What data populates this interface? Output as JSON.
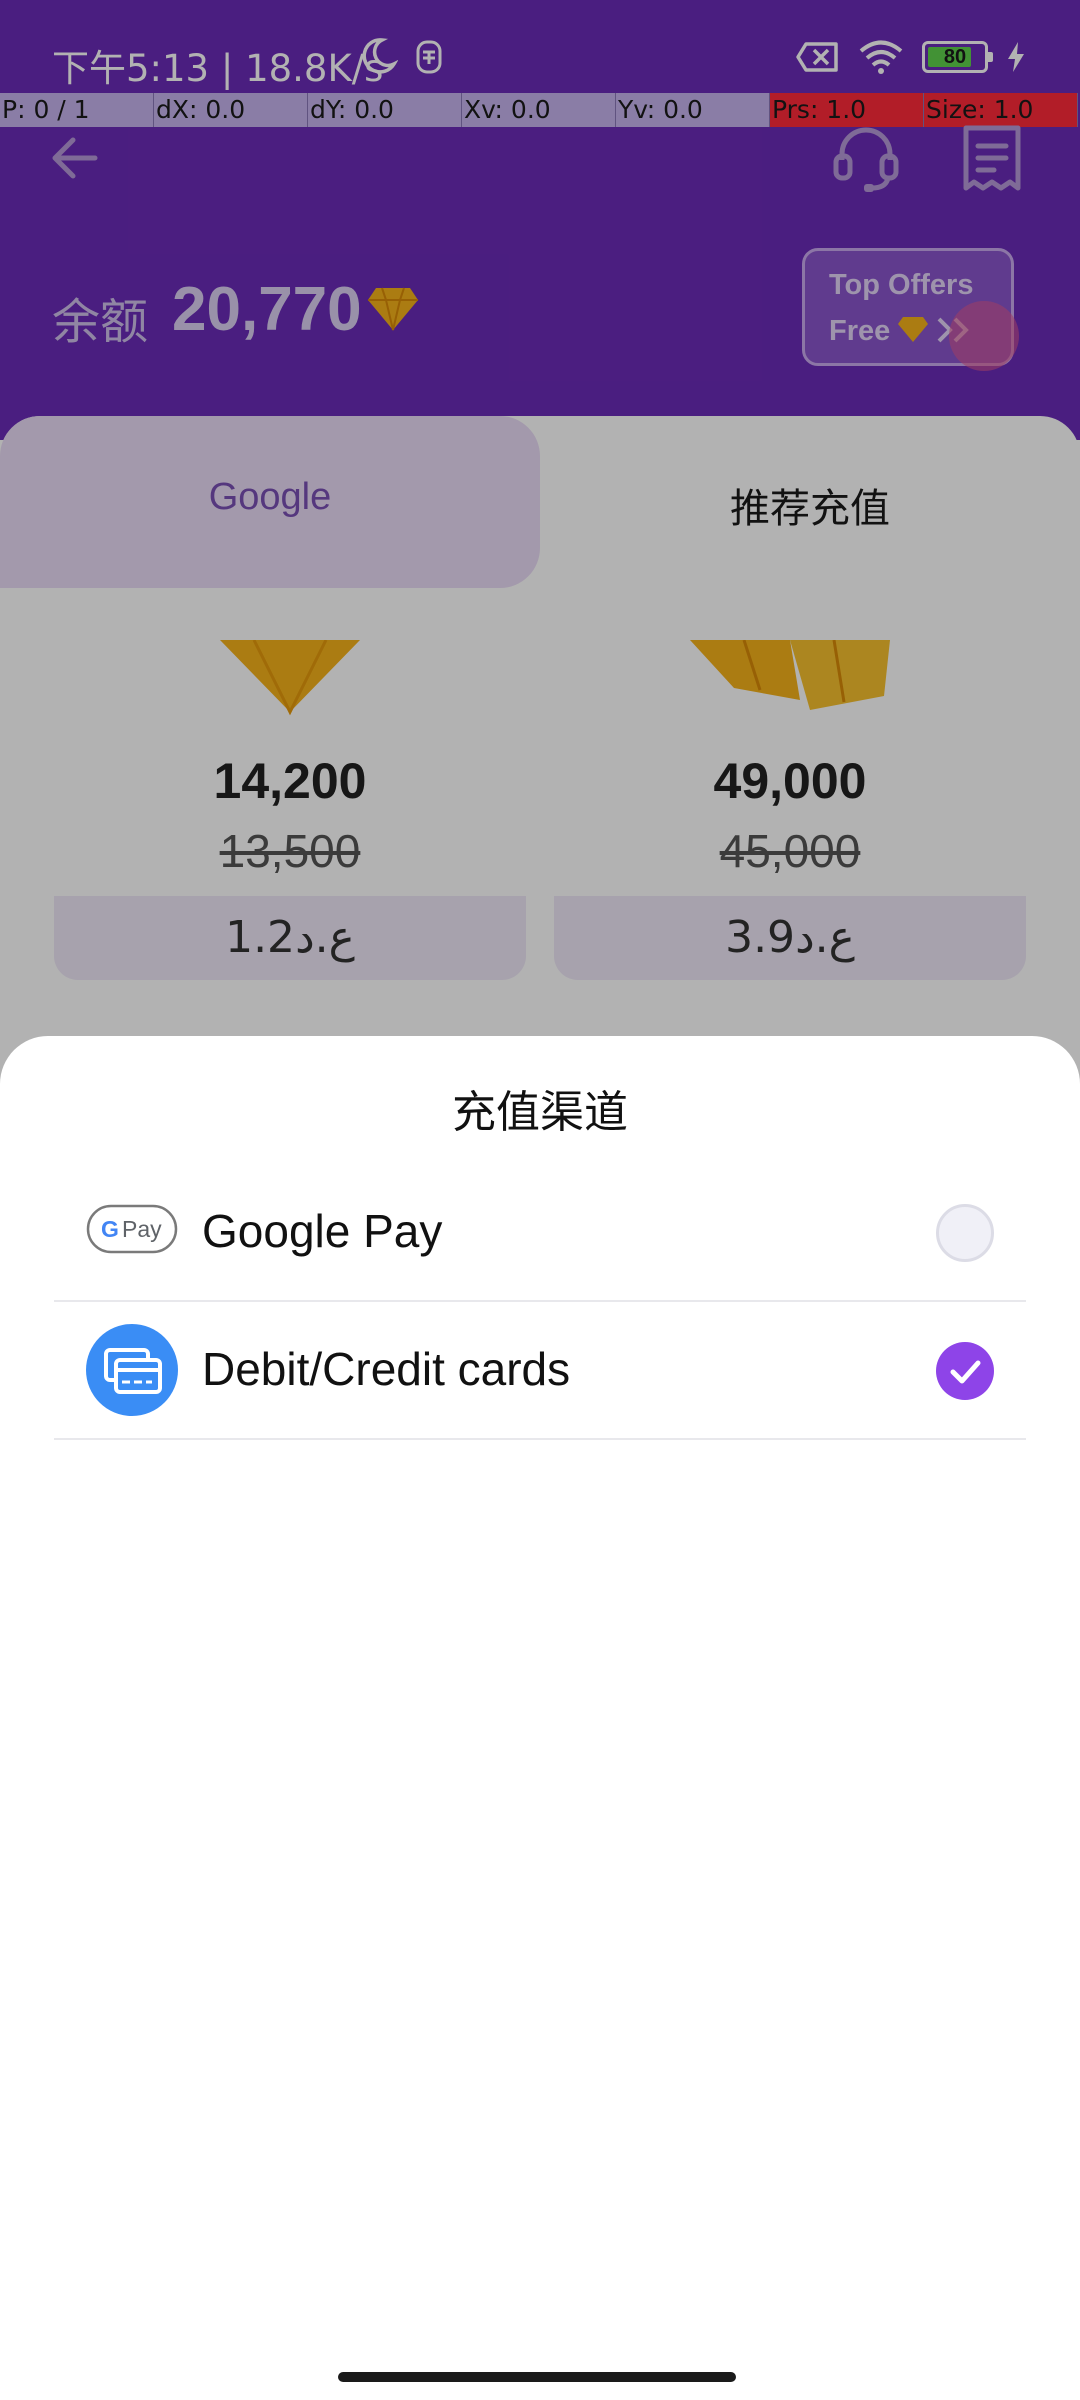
{
  "status_bar": {
    "time": "下午5:13 | 18.8K/s",
    "battery": "80"
  },
  "debug_bar": [
    "P: 0 / 1",
    "dX: 0.0",
    "dY: 0.0",
    "Xv: 0.0",
    "Yv: 0.0",
    "Prs: 1.0",
    "Size: 1.0"
  ],
  "header": {
    "balance_label": "余额",
    "balance_value": "20,770",
    "top_offers_line1": "Top Offers",
    "top_offers_line2": "Free"
  },
  "tabs": [
    {
      "label": "Google",
      "selected": false
    },
    {
      "label": "推荐充值",
      "selected": true
    }
  ],
  "packages": [
    {
      "amount": "14,200",
      "original": "13,500",
      "price": "1.2ع.د"
    },
    {
      "amount": "49,000",
      "original": "45,000",
      "price": "3.9ع.د"
    }
  ],
  "sheet": {
    "title": "充值渠道",
    "options": [
      {
        "label": "Google Pay",
        "logo": "Pay",
        "selected": false
      },
      {
        "label": "Debit/Credit cards",
        "selected": true
      }
    ]
  },
  "colors": {
    "header_purple": "#6b2bb8",
    "accent_purple": "#8e44e8",
    "card_blue": "#3a8df5",
    "gem_gold": "#f5b21a"
  }
}
